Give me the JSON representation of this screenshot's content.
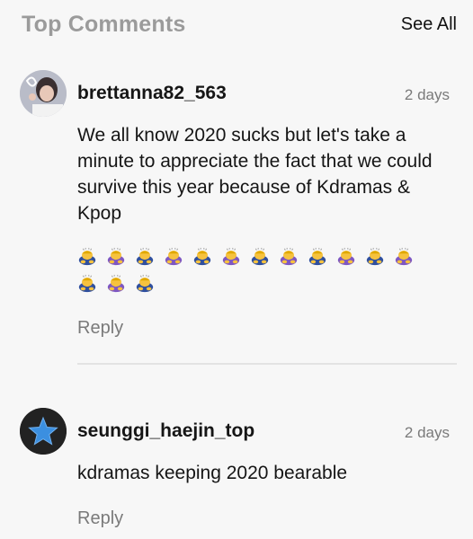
{
  "header": {
    "title": "Top Comments",
    "see_all": "See All"
  },
  "comments": [
    {
      "user": "brettanna82_563",
      "time": "2 days",
      "text": "We all know 2020 sucks but let's take a minute to appreciate the fact that we could survive this year because of Kdramas & Kpop",
      "emoji_name": "person-bowing-emoji",
      "emoji_count": 15,
      "reply": "Reply"
    },
    {
      "user": "seunggi_haejin_top",
      "time": "2 days",
      "text": "kdramas keeping 2020 bearable",
      "reply": "Reply",
      "avatar_icon": "star-icon"
    }
  ],
  "colors": {
    "background": "#f7f7f7",
    "muted": "#7a7a7a",
    "title_gray": "#9b9b9b",
    "star_blue": "#3b8fe0",
    "avatar_dark": "#222222"
  }
}
